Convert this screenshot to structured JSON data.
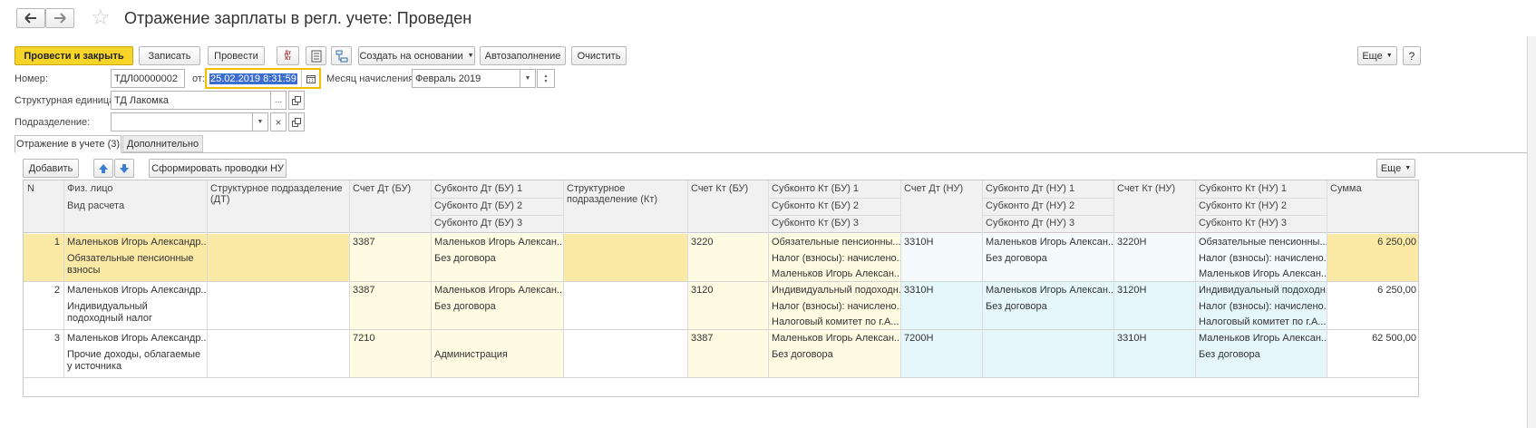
{
  "window": {
    "title": "Отражение зарплаты в регл. учете: Проведен"
  },
  "toolbar": {
    "post_close": "Провести и закрыть",
    "save": "Записать",
    "post": "Провести",
    "dtkt_icon_text": "Дт Кт",
    "create_based": "Создать на основании",
    "autofill": "Автозаполнение",
    "clear": "Очистить",
    "more": "Еще",
    "help": "?"
  },
  "form": {
    "number_label": "Номер:",
    "number_value": "ТДЛ00000002",
    "date_label": "от:",
    "date_value": "25.02.2019  8:31:59",
    "month_label": "Месяц начисления:",
    "month_value": "Февраль 2019",
    "struct_unit_label": "Структурная единица:",
    "struct_unit_value": "ТД Лакомка",
    "struct_unit_more": "...",
    "department_label": "Подразделение:",
    "department_value": "",
    "clear_symbol": "×"
  },
  "tabs": [
    {
      "label": "Отражение в учете (3)",
      "active": true
    },
    {
      "label": "Дополнительно",
      "active": false
    }
  ],
  "table_toolbar": {
    "add": "Добавить",
    "generate": "Сформировать проводки НУ",
    "more": "Еще"
  },
  "table": {
    "headers": {
      "n": "N",
      "person": "Физ. лицо",
      "calc_type": "Вид расчета",
      "struct_dt": "Структурное подразделение (ДТ)",
      "acc_dt_bu": "Счет Дт (БУ)",
      "sub_dt_bu_1": "Субконто Дт  (БУ) 1",
      "sub_dt_bu_2": "Субконто Дт  (БУ) 2",
      "sub_dt_bu_3": "Субконто Дт  (БУ) 3",
      "struct_kt": "Структурное подразделение (Кт)",
      "acc_kt_bu": "Счет Кт  (БУ)",
      "sub_kt_bu_1": "Субконто Кт  (БУ) 1",
      "sub_kt_bu_2": "Субконто Кт  (БУ) 2",
      "sub_kt_bu_3": "Субконто Кт  (БУ) 3",
      "acc_dt_nu": "Счет Дт (НУ)",
      "sub_dt_nu_1": "Субконто Дт (НУ) 1",
      "sub_dt_nu_2": "Субконто Дт (НУ) 2",
      "sub_dt_nu_3": "Субконто Дт (НУ) 3",
      "acc_kt_nu": "Счет Кт (НУ)",
      "sub_kt_nu_1": "Субконто Кт (НУ) 1",
      "sub_kt_nu_2": "Субконто Кт (НУ) 2",
      "sub_kt_nu_3": "Субконто Кт (НУ) 3",
      "sum": "Сумма"
    },
    "rows": [
      {
        "n": "1",
        "person": "Маленьков Игорь Александр...",
        "calc_type": "Обязательные пенсионные взносы",
        "struct_dt": "",
        "acc_dt_bu": "3387",
        "sub_dt_bu_1": "Маленьков Игорь Алексан...",
        "sub_dt_bu_2": "Без договора",
        "sub_dt_bu_3": "",
        "struct_kt": "",
        "acc_kt_bu": "3220",
        "sub_kt_bu_1": "Обязательные пенсионны...",
        "sub_kt_bu_2": "Налог (взносы): начислено...",
        "sub_kt_bu_3": "Маленьков Игорь Алексан...",
        "acc_dt_nu": "3310Н",
        "sub_dt_nu_1": "Маленьков Игорь Алексан...",
        "sub_dt_nu_2": "Без договора",
        "sub_dt_nu_3": "",
        "acc_kt_nu": "3220Н",
        "sub_kt_nu_1": "Обязательные пенсионны...",
        "sub_kt_nu_2": "Налог (взносы): начислено...",
        "sub_kt_nu_3": "Маленьков Игорь Алексан...",
        "sum": "6 250,00"
      },
      {
        "n": "2",
        "person": "Маленьков Игорь Александр...",
        "calc_type": "Индивидуальный подоходный налог",
        "struct_dt": "",
        "acc_dt_bu": "3387",
        "sub_dt_bu_1": "Маленьков Игорь Алексан...",
        "sub_dt_bu_2": "Без договора",
        "sub_dt_bu_3": "",
        "struct_kt": "",
        "acc_kt_bu": "3120",
        "sub_kt_bu_1": "Индивидуальный подоходн...",
        "sub_kt_bu_2": "Налог (взносы): начислено...",
        "sub_kt_bu_3": "Налоговый комитет по г.А...",
        "acc_dt_nu": "3310Н",
        "sub_dt_nu_1": "Маленьков Игорь Алексан...",
        "sub_dt_nu_2": "Без договора",
        "sub_dt_nu_3": "",
        "acc_kt_nu": "3120Н",
        "sub_kt_nu_1": "Индивидуальный подоходн...",
        "sub_kt_nu_2": "Налог (взносы): начислено...",
        "sub_kt_nu_3": "Налоговый комитет по г.А...",
        "sum": "6 250,00"
      },
      {
        "n": "3",
        "person": "Маленьков Игорь Александр...",
        "calc_type": "Прочие доходы, облагаемые у источника",
        "struct_dt": "",
        "acc_dt_bu": "7210",
        "sub_dt_bu_1": "",
        "sub_dt_bu_2": "Администрация",
        "sub_dt_bu_3": "",
        "struct_kt": "",
        "acc_kt_bu": "3387",
        "sub_kt_bu_1": "Маленьков Игорь Алексан...",
        "sub_kt_bu_2": "Без договора",
        "sub_kt_bu_3": "",
        "acc_dt_nu": "7200Н",
        "sub_dt_nu_1": "",
        "sub_dt_nu_2": "",
        "sub_dt_nu_3": "",
        "acc_kt_nu": "3310Н",
        "sub_kt_nu_1": "Маленьков Игорь Алексан...",
        "sub_kt_nu_2": "Без договора",
        "sub_kt_nu_3": "",
        "sum": "62 500,00"
      }
    ]
  },
  "colors": {
    "primary_button": "#f7d528",
    "selected_row": "#fbe9a6",
    "bu_highlight": "#fefbe3",
    "nu_highlight": "#e6f7fb",
    "date_focus_border": "#f0c000",
    "date_selection": "#3b6ccf"
  }
}
